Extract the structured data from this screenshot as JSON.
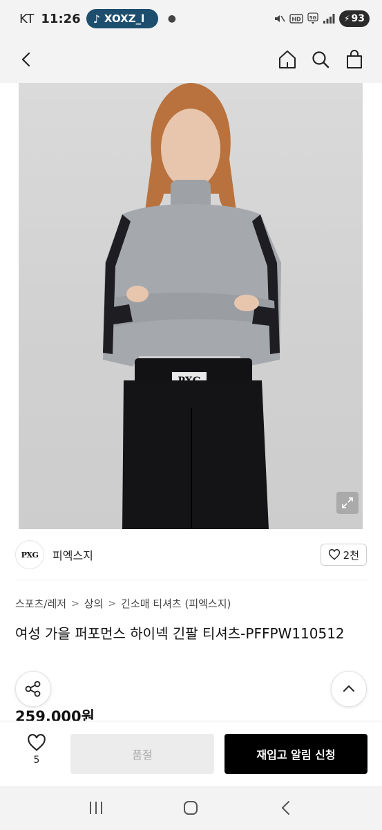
{
  "status_bar": {
    "carrier": "KT",
    "time": "11:26",
    "music_label": "XOXZ_l",
    "battery": "93",
    "indicators": [
      "mute-icon",
      "hd-icon",
      "5g-icon",
      "signal-icon"
    ]
  },
  "header": {
    "icons": [
      "back-icon",
      "home-icon",
      "search-icon",
      "shopping-bag-icon"
    ]
  },
  "product": {
    "image_alt": "PXG women's grey high-neck long sleeve top with black stripe sleeves",
    "brand_logo": "PXG",
    "brand_name": "피엑스지",
    "likes": "2천",
    "breadcrumb": [
      "스포츠/레저",
      "상의",
      "긴소매 티셔츠 (피엑스지)"
    ],
    "title": "여성 가을 퍼포먼스 하이넥 긴팔 티셔츠-PFFPW110512",
    "price": "259,000원"
  },
  "action_bar": {
    "wish_count": "5",
    "soldout_label": "품절",
    "restock_label": "재입고 알림 신청"
  },
  "colors": {
    "bar_bg": "#f3f3f3",
    "music_pill": "#1d4e6e",
    "primary_button": "#000000",
    "disabled_button": "#ececec"
  }
}
